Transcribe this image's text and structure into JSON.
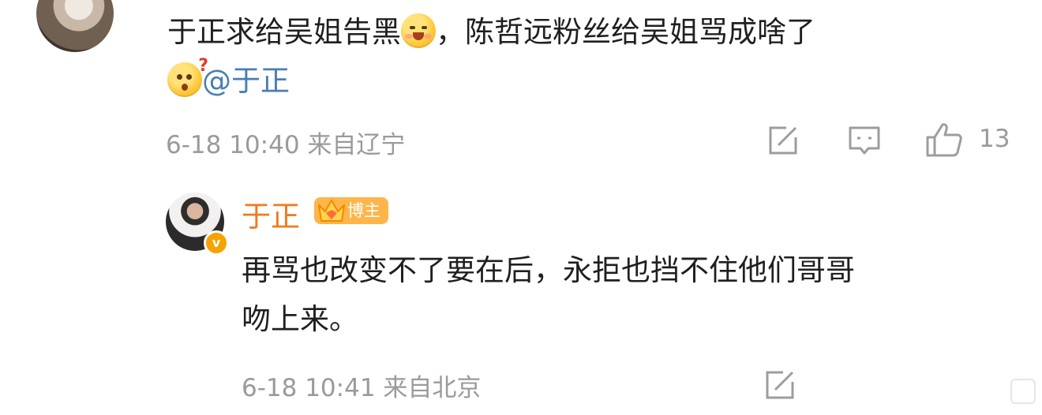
{
  "comment": {
    "text_line1_a": "于正求给吴姐告黑",
    "emoji1": "hug-smile-emoji",
    "text_line1_b": "，陈哲远粉丝给吴姐骂成啥了",
    "emoji2": "confused-emoji",
    "mention": "@于正",
    "date_time": "6-18 10:40",
    "location": "来自辽宁",
    "like_count": "13"
  },
  "reply": {
    "author": "于正",
    "badge_label": "博主",
    "text_line1": "再骂也改变不了要在后，永拒也挡不住他们哥哥",
    "text_line2": "吻上来。",
    "date_time": "6-18 10:41",
    "location": "来自北京"
  },
  "colors": {
    "author_name": "#ef7b1e",
    "mention": "#4a7fb0",
    "meta": "#9a9a9a",
    "badge": "#ffb54a"
  }
}
